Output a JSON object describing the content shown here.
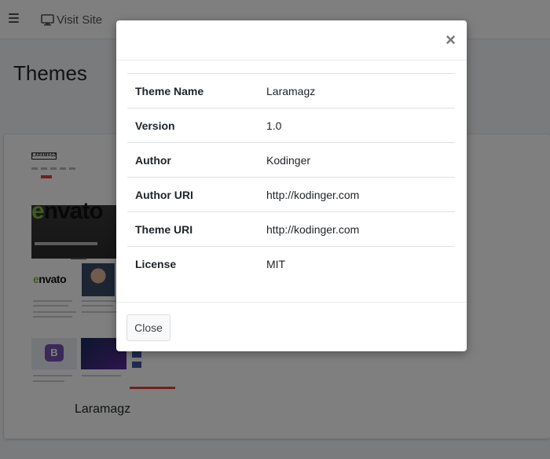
{
  "topbar": {
    "visit_site_label": "Visit Site"
  },
  "page": {
    "title": "Themes"
  },
  "theme_card": {
    "name": "Laramagz",
    "thumbnail_texts": {
      "logo": "LARAMAGZ",
      "brand_text_prefix": "e",
      "brand_text_suffix": "nvato",
      "bootstrap_letter": "B"
    }
  },
  "modal": {
    "close_icon": "×",
    "rows": [
      {
        "label": "Theme Name",
        "value": "Laramagz"
      },
      {
        "label": "Version",
        "value": "1.0"
      },
      {
        "label": "Author",
        "value": "Kodinger"
      },
      {
        "label": "Author URI",
        "value": "http://kodinger.com"
      },
      {
        "label": "Theme URI",
        "value": "http://kodinger.com"
      },
      {
        "label": "License",
        "value": "MIT"
      }
    ],
    "close_button_label": "Close"
  },
  "colors": {
    "backdrop": "rgba(0,0,0,0.5)",
    "envato_green": "#82b541",
    "accent_red": "#e53e3e"
  }
}
